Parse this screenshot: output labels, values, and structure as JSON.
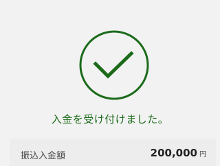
{
  "status": {
    "icon": "check-circle-icon",
    "color": "#1b6b1b",
    "message": "入金を受け付けました。"
  },
  "deposit": {
    "label": "振込入金額",
    "amount": "200,000",
    "unit": "円"
  }
}
